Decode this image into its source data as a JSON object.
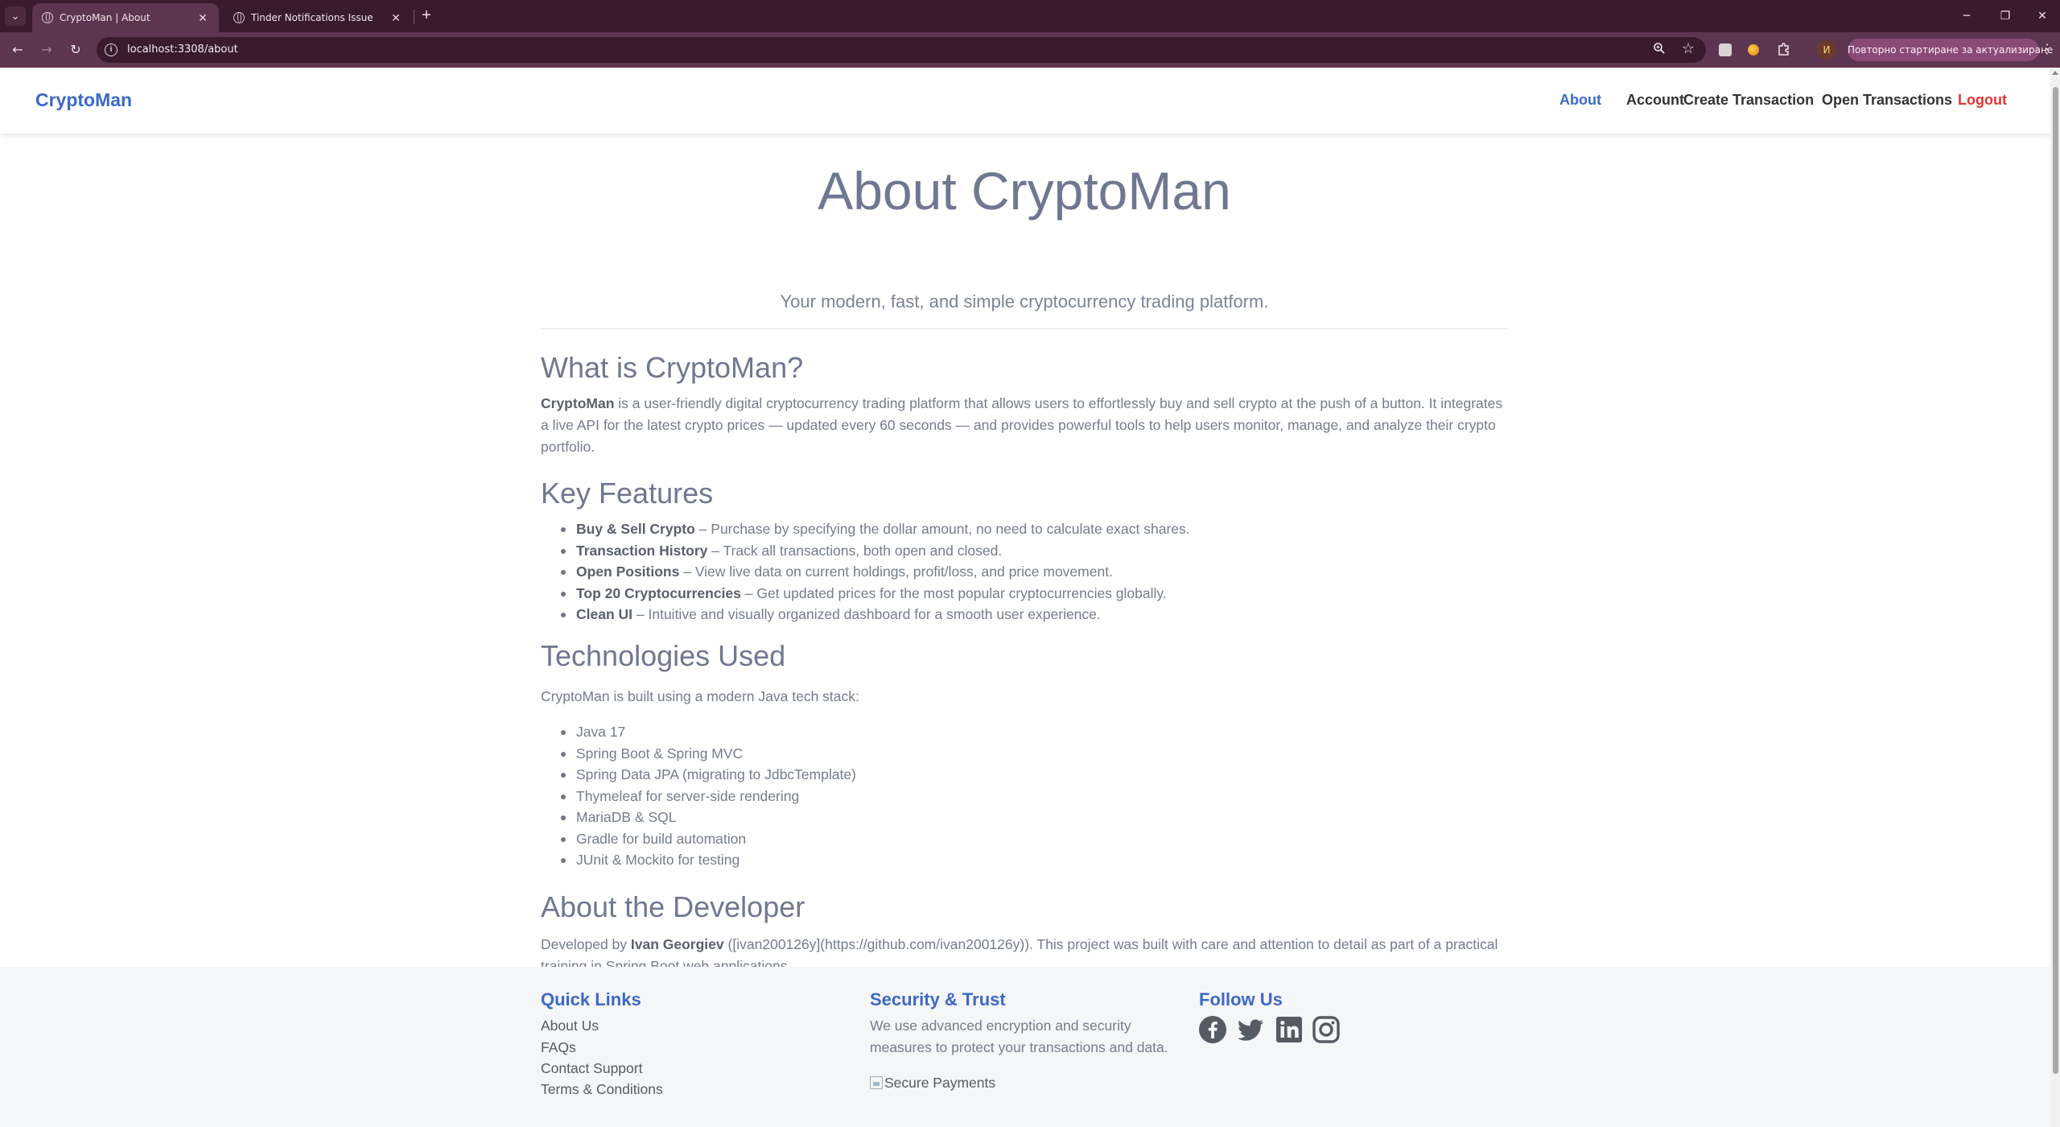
{
  "browser": {
    "tabs": [
      {
        "title": "CryptoMan | About",
        "active": true
      },
      {
        "title": "Tinder Notifications Issue",
        "active": false
      }
    ],
    "address": "localhost:3308/about",
    "update_button": "Повторно стартиране за актуализиране",
    "profile_initial": "И"
  },
  "nav": {
    "brand": "CryptoMan",
    "links": [
      "About",
      "Account",
      "Create Transaction",
      "Open Transactions"
    ],
    "logout": "Logout"
  },
  "hero": {
    "title": "About CryptoMan",
    "subtitle": "Your modern, fast, and simple cryptocurrency trading platform."
  },
  "what": {
    "heading": "What is CryptoMan?",
    "bold": "CryptoMan",
    "text": " is a user-friendly digital cryptocurrency trading platform that allows users to effortlessly buy and sell crypto at the push of a button. It integrates a live API for the latest crypto prices — updated every 60 seconds — and provides powerful tools to help users monitor, manage, and analyze their crypto portfolio."
  },
  "features": {
    "heading": "Key Features",
    "items": [
      {
        "bold": "Buy & Sell Crypto",
        "text": " – Purchase by specifying the dollar amount, no need to calculate exact shares."
      },
      {
        "bold": "Transaction History",
        "text": " – Track all transactions, both open and closed."
      },
      {
        "bold": "Open Positions",
        "text": " – View live data on current holdings, profit/loss, and price movement."
      },
      {
        "bold": "Top 20 Cryptocurrencies",
        "text": " – Get updated prices for the most popular cryptocurrencies globally."
      },
      {
        "bold": "Clean UI",
        "text": " – Intuitive and visually organized dashboard for a smooth user experience."
      }
    ]
  },
  "tech": {
    "heading": "Technologies Used",
    "intro": "CryptoMan is built using a modern Java tech stack:",
    "items": [
      "Java 17",
      "Spring Boot & Spring MVC",
      "Spring Data JPA (migrating to JdbcTemplate)",
      "Thymeleaf for server-side rendering",
      "MariaDB & SQL",
      "Gradle for build automation",
      "JUnit & Mockito for testing"
    ]
  },
  "developer": {
    "heading": "About the Developer",
    "prefix": "Developed by ",
    "name": "Ivan Georgiev",
    "text": " ([ivan200126y](https://github.com/ivan200126y)). This project was built with care and attention to detail as part of a practical training in Spring Boot web applications."
  },
  "footer": {
    "quick_links": {
      "heading": "Quick Links",
      "items": [
        "About Us",
        "FAQs",
        "Contact Support",
        "Terms & Conditions"
      ]
    },
    "security": {
      "heading": "Security & Trust",
      "text": "We use advanced encryption and security measures to protect your transactions and data.",
      "image_alt": "Secure Payments"
    },
    "follow": {
      "heading": "Follow Us",
      "icons": [
        "facebook-icon",
        "twitter-icon",
        "linkedin-icon",
        "instagram-icon"
      ]
    }
  },
  "colors": {
    "accent": "#3c69c7",
    "logout": "#e3342f",
    "chrome": "#5c3550"
  }
}
